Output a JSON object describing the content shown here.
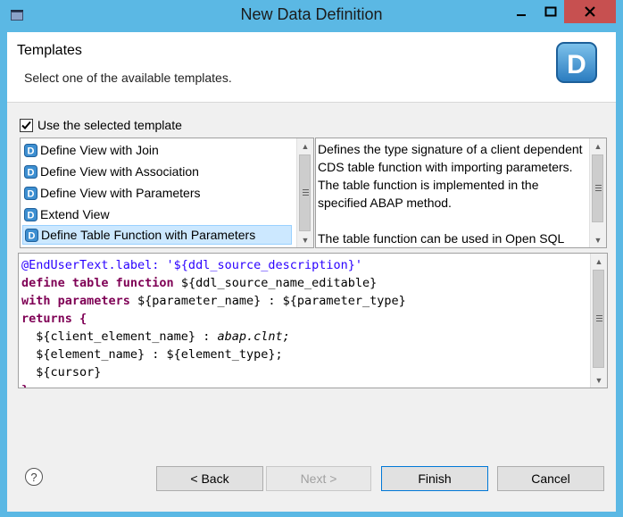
{
  "window": {
    "title": "New Data Definition"
  },
  "header": {
    "title": "Templates",
    "subtitle": "Select one of the available templates."
  },
  "use_template": {
    "label": "Use the selected template",
    "checked": true
  },
  "templates": [
    {
      "label": "Define View with Join"
    },
    {
      "label": "Define View with Association"
    },
    {
      "label": "Define View with Parameters"
    },
    {
      "label": "Extend View"
    },
    {
      "label": "Define Table Function with Parameters",
      "selected": true
    }
  ],
  "description": {
    "paragraph1": "Defines the type signature of a client dependent CDS table function with importing parameters. The table function is implemented in the specified ABAP method.",
    "paragraph2": "The table function can be used in Open SQL"
  },
  "code": {
    "line1": "@EndUserText.label: '${ddl_source_description}'",
    "line2_kw": "define table function ",
    "line2_var": "${ddl_source_name_editable}",
    "line3_kw": "with parameters ",
    "line3_var": "${parameter_name} : ${parameter_type}",
    "line4_kw": "returns {",
    "line5_var": "  ${client_element_name} : ",
    "line5_type": "abap.clnt;",
    "line6": "  ${element_name} : ${element_type};",
    "line7": "  ${cursor}",
    "line8": "}"
  },
  "buttons": {
    "back": "< Back",
    "next": "Next >",
    "finish": "Finish",
    "cancel": "Cancel",
    "help": "?"
  },
  "colors": {
    "titlebar": "#5bb8e4",
    "close": "#c75050",
    "selection": "#cce8ff",
    "keyword": "#7f0055",
    "string": "#2a00ff"
  }
}
